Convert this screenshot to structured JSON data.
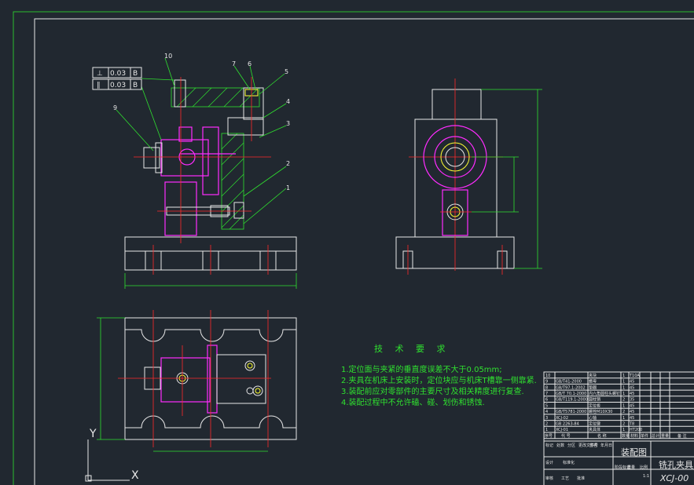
{
  "tech_requirements": {
    "title": "技 术 要 求",
    "items": [
      "1.定位面与夹紧的垂直度误差不大于0.05mm;",
      "2.夹具在机床上安装时，定位块应与机床T槽靠一侧靠紧.",
      "3.装配前应对零部件的主要尺寸及相关精度进行复查.",
      "4.装配过程中不允许磕、碰、划伤和锈蚀."
    ]
  },
  "feature_control_frames": [
    {
      "symbol": "⊥",
      "value": "0.03",
      "datum": "B"
    },
    {
      "symbol": "∥",
      "value": "0.03",
      "datum": "B"
    }
  ],
  "balloons": [
    "10",
    "7",
    "6",
    "5",
    "4",
    "3",
    "2",
    "1",
    "9"
  ],
  "axes": {
    "y_label": "Y",
    "x_label": "X"
  },
  "title_block": {
    "drawing_name": "装配图",
    "product_name": "铣孔夹具",
    "drawing_number": "XCJ-00",
    "header_cells": [
      "序号",
      "代 号",
      "名 称",
      "数量",
      "材料",
      "单件",
      "总计",
      "重量",
      "备 注"
    ],
    "parts": [
      {
        "no": "10",
        "code": "",
        "name": "夹块",
        "qty": "1",
        "mat": "T10A"
      },
      {
        "no": "9",
        "code": "GB/T41-2000",
        "name": "螺母",
        "qty": "1",
        "mat": "45"
      },
      {
        "no": "8",
        "code": "GB/T97.1-2002",
        "name": "垫圈",
        "qty": "1",
        "mat": "45"
      },
      {
        "no": "7",
        "code": "GB/T 70.1-2000",
        "name": "内六角圆柱头螺钉",
        "qty": "1",
        "mat": "45"
      },
      {
        "no": "6",
        "code": "GB/T119.1-2000",
        "name": "圆柱销",
        "qty": "2",
        "mat": "35"
      },
      {
        "no": "5",
        "code": "",
        "name": "定位板",
        "qty": "1",
        "mat": "45"
      },
      {
        "no": "4",
        "code": "GB/T5781-2000",
        "name": "螺栓M10X30",
        "qty": "2",
        "mat": "45"
      },
      {
        "no": "3",
        "code": "XCJ-02",
        "name": "心轴",
        "qty": "1",
        "mat": "45"
      },
      {
        "no": "2",
        "code": "GB 2263-84",
        "name": "定位键",
        "qty": "2",
        "mat": "T8"
      },
      {
        "no": "1",
        "code": "XCJ-01",
        "name": "夹具体",
        "qty": "1",
        "mat": "HT200"
      }
    ],
    "sign_cells": [
      "标记",
      "处数",
      "分区",
      "更改文件号",
      "签名",
      "年月日",
      "设计",
      "标准化",
      "审核",
      "工艺",
      "批准",
      "阶段标记",
      "重量",
      "比例"
    ],
    "scale": "1:1"
  }
}
